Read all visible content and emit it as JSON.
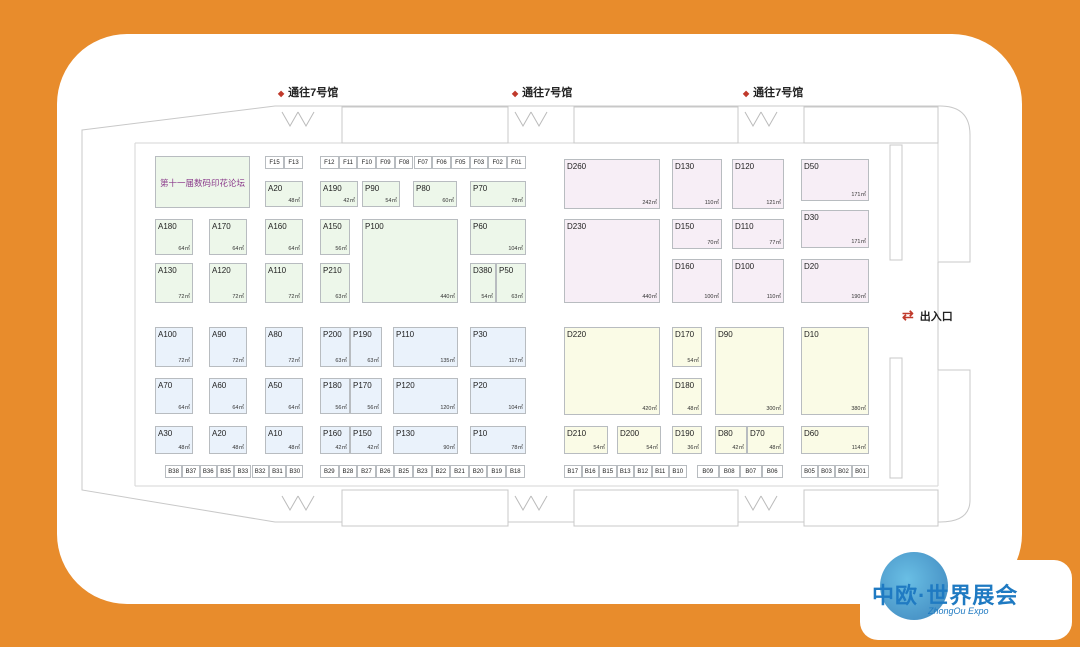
{
  "gates": {
    "top": "通往7号馆",
    "exit": "出入口"
  },
  "forum": "第十一届数码印花论坛",
  "logo": {
    "cn": "中欧·世界展会",
    "en": "ZhongOu Expo"
  },
  "colors": {
    "background": "#E88C2C",
    "green": "#edf7ea",
    "blue": "#eaf2fb",
    "pink": "#f7eef6",
    "yellow": "#fafbe6"
  },
  "booths": {
    "A20t": {
      "id": "A20",
      "area": "48㎡"
    },
    "A190": {
      "id": "A190",
      "area": "42㎡"
    },
    "P90": {
      "id": "P90",
      "area": "54㎡"
    },
    "P80": {
      "id": "P80",
      "area": "60㎡"
    },
    "P70": {
      "id": "P70",
      "area": "78㎡"
    },
    "A180": {
      "id": "A180",
      "area": "64㎡"
    },
    "A170": {
      "id": "A170",
      "area": "64㎡"
    },
    "A160": {
      "id": "A160",
      "area": "64㎡"
    },
    "A150": {
      "id": "A150",
      "area": "56㎡"
    },
    "P100": {
      "id": "P100",
      "area": "440㎡"
    },
    "P60": {
      "id": "P60",
      "area": "104㎡"
    },
    "A130": {
      "id": "A130",
      "area": "72㎡"
    },
    "A120": {
      "id": "A120",
      "area": "72㎡"
    },
    "A110": {
      "id": "A110",
      "area": "72㎡"
    },
    "P210": {
      "id": "P210",
      "area": "63㎡"
    },
    "D380": {
      "id": "D380",
      "area": "54㎡"
    },
    "P50": {
      "id": "P50",
      "area": "63㎡"
    },
    "A100": {
      "id": "A100",
      "area": "72㎡"
    },
    "A90": {
      "id": "A90",
      "area": "72㎡"
    },
    "A80": {
      "id": "A80",
      "area": "72㎡"
    },
    "P200": {
      "id": "P200",
      "area": "63㎡"
    },
    "P190": {
      "id": "P190",
      "area": "63㎡"
    },
    "P110": {
      "id": "P110",
      "area": "135㎡"
    },
    "P30": {
      "id": "P30",
      "area": "117㎡"
    },
    "A70": {
      "id": "A70",
      "area": "64㎡"
    },
    "A60": {
      "id": "A60",
      "area": "64㎡"
    },
    "A50": {
      "id": "A50",
      "area": "64㎡"
    },
    "P180": {
      "id": "P180",
      "area": "56㎡"
    },
    "P170": {
      "id": "P170",
      "area": "56㎡"
    },
    "P120": {
      "id": "P120",
      "area": "120㎡"
    },
    "P20": {
      "id": "P20",
      "area": "104㎡"
    },
    "A30": {
      "id": "A30",
      "area": "48㎡"
    },
    "A20b": {
      "id": "A20",
      "area": "48㎡"
    },
    "A10": {
      "id": "A10",
      "area": "48㎡"
    },
    "P160": {
      "id": "P160",
      "area": "42㎡"
    },
    "P150": {
      "id": "P150",
      "area": "42㎡"
    },
    "P130": {
      "id": "P130",
      "area": "90㎡"
    },
    "P10": {
      "id": "P10",
      "area": "78㎡"
    },
    "D260": {
      "id": "D260",
      "area": "242㎡"
    },
    "D130": {
      "id": "D130",
      "area": "110㎡"
    },
    "D120": {
      "id": "D120",
      "area": "121㎡"
    },
    "D50": {
      "id": "D50",
      "area": "171㎡"
    },
    "D230": {
      "id": "D230",
      "area": "440㎡"
    },
    "D150": {
      "id": "D150",
      "area": "70㎡"
    },
    "D110": {
      "id": "D110",
      "area": "77㎡"
    },
    "D30": {
      "id": "D30",
      "area": "171㎡"
    },
    "D160": {
      "id": "D160",
      "area": "100㎡"
    },
    "D100": {
      "id": "D100",
      "area": "110㎡"
    },
    "D20": {
      "id": "D20",
      "area": "190㎡"
    },
    "D220": {
      "id": "D220",
      "area": "420㎡"
    },
    "D170": {
      "id": "D170",
      "area": "54㎡"
    },
    "D90": {
      "id": "D90",
      "area": "300㎡"
    },
    "D10": {
      "id": "D10",
      "area": "380㎡"
    },
    "D180": {
      "id": "D180",
      "area": "48㎡"
    },
    "D210": {
      "id": "D210",
      "area": "54㎡"
    },
    "D200": {
      "id": "D200",
      "area": "54㎡"
    },
    "D190": {
      "id": "D190",
      "area": "36㎡"
    },
    "D80": {
      "id": "D80",
      "area": "42㎡"
    },
    "D70": {
      "id": "D70",
      "area": "48㎡"
    },
    "D60": {
      "id": "D60",
      "area": "114㎡"
    }
  },
  "frow": [
    "F12",
    "F11",
    "F10",
    "F09",
    "F08",
    "F07",
    "F06",
    "F05",
    "F03",
    "F02",
    "F01"
  ],
  "fleft": [
    "F15",
    "F13"
  ],
  "b1": [
    "B38",
    "B37",
    "B36",
    "B35",
    "B33",
    "B32",
    "B31",
    "B30"
  ],
  "b2": [
    "B29",
    "B28",
    "B27",
    "B26",
    "B25",
    "B23",
    "B22",
    "B21",
    "B20",
    "B19",
    "B18"
  ],
  "b3": [
    "B17",
    "B16",
    "B15",
    "B13",
    "B12",
    "B11",
    "B10"
  ],
  "b4": [
    "B09",
    "B08",
    "B07",
    "B06"
  ],
  "b5": [
    "B05",
    "B03",
    "B02",
    "B01"
  ]
}
